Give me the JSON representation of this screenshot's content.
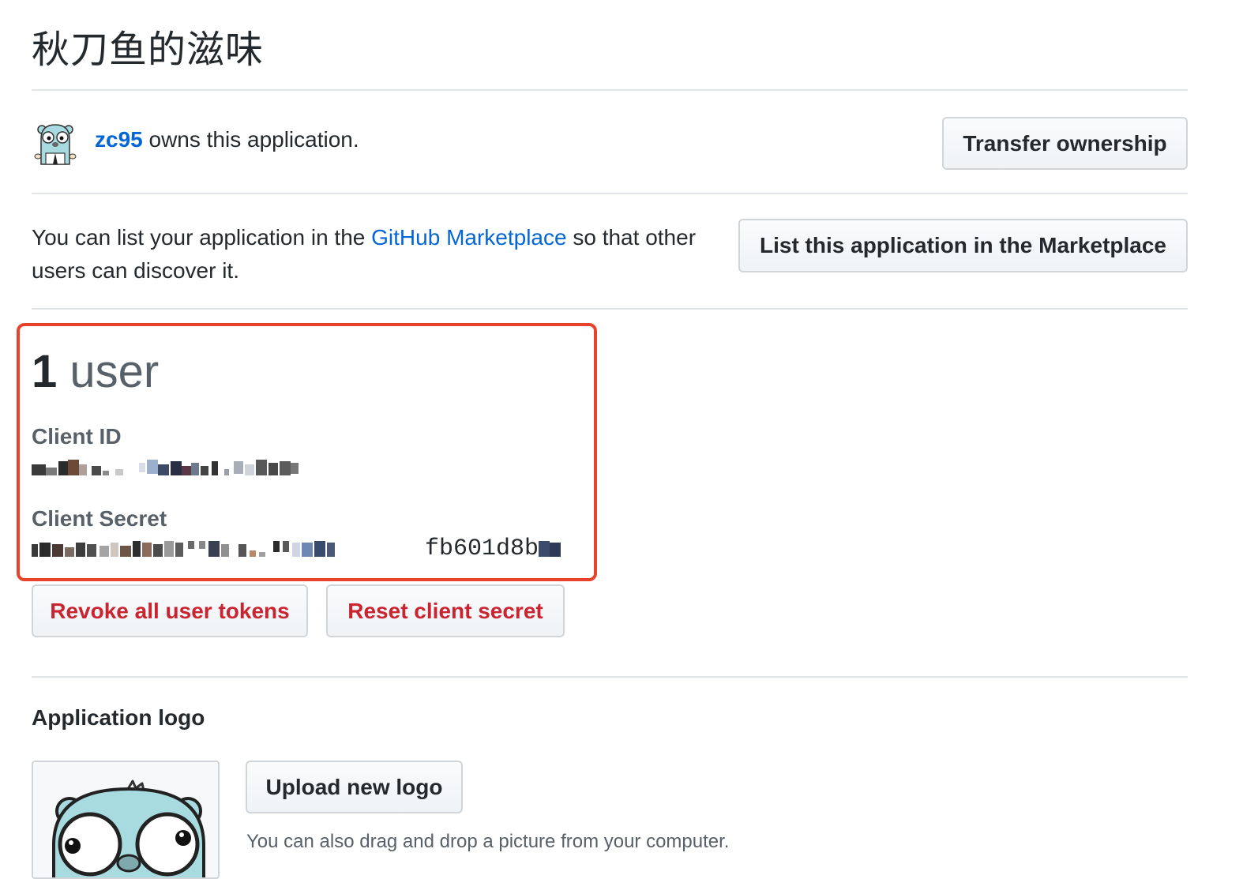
{
  "page": {
    "title": "秋刀鱼的滋味"
  },
  "owner": {
    "username": "zc95",
    "suffix": " owns this application.",
    "transfer_label": "Transfer ownership"
  },
  "marketplace": {
    "text_before": "You can list your application in the ",
    "link_text": "GitHub Marketplace",
    "text_after": " so that other users can discover it.",
    "button_label": "List this application in the Marketplace"
  },
  "users": {
    "count": "1",
    "label": "user"
  },
  "credentials": {
    "client_id_label": "Client ID",
    "client_secret_label": "Client Secret",
    "client_secret_visible_tail": "fb601d8b"
  },
  "actions": {
    "revoke_label": "Revoke all user tokens",
    "reset_label": "Reset client secret"
  },
  "logo_section": {
    "title": "Application logo",
    "upload_label": "Upload new logo",
    "drag_note": "You can also drag and drop a picture from your computer."
  },
  "colors": {
    "link": "#0366d6",
    "danger": "#cb2431",
    "highlight": "#e8412c",
    "gopher": "#a8dbe0"
  }
}
